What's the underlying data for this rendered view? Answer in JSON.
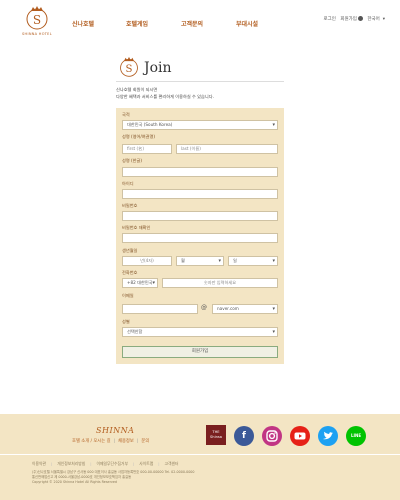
{
  "header": {
    "logo_text": "SHINNA HOTEL",
    "nav": [
      "신나호텔",
      "호텔게임",
      "고객문의",
      "부대시설"
    ],
    "login": "로그인",
    "signup": "회원가입",
    "language": "한국어"
  },
  "join": {
    "title": "Join",
    "intro_line1": "신나호텔 회원이 되시면",
    "intro_line2": "다양한 혜택과 서비스를 편리하게 이용하실 수 있습니다."
  },
  "form": {
    "country_label": "국적",
    "country_value": "대한민국 (South Korea)",
    "name_en_label": "성명 (영어/여권명)",
    "first_placeholder": "first (名)",
    "last_placeholder": "last (이름)",
    "name_ko_label": "성명 (한글)",
    "id_label": "아이디",
    "password_label": "비밀번호",
    "password_confirm_label": "비밀번호 재확인",
    "birth_label": "생년월일",
    "birth_year": "년(4자)",
    "birth_month": "월",
    "birth_day": "일",
    "phone_label": "전화번호",
    "phone_code": "+82 대한민국",
    "phone_placeholder": "숫자만 입력하세요",
    "email_label": "이메일",
    "email_at": "@",
    "email_domain": "naver.com",
    "gender_label": "성별",
    "gender_value": "선택안함",
    "submit_label": "회원가입"
  },
  "footer": {
    "brand": "SHINNA",
    "links": [
      "호텔 소개 / 오시는 길",
      "채용정보",
      "문의"
    ],
    "the_shinsa_line1": "THE",
    "the_shinsa_line2": "Shinsa",
    "social": {
      "facebook_color": "#3b5998",
      "instagram_color": "#c13584",
      "youtube_color": "#e62117",
      "twitter_color": "#1da1f2",
      "line_color": "#00c300",
      "line_label": "LINE"
    },
    "bottom_links": [
      "이용약관",
      "개인정보처리방침",
      "이메일무단수집거부",
      "사이트맵",
      "고객센터"
    ],
    "copy_line1": "(주)신나호텔 서울특별시 강남구 신사동 000 대표이사 홍길동 사업자등록번호 000-00-00000 Tel. 02-0000-0000",
    "copy_line2": "통신판매업신고 제 0000-서울강남-0000호 개인정보보호책임자 홍길동",
    "copy_line3": "Copyright © 2020 Shinna Hotel All Rights Reserved"
  }
}
